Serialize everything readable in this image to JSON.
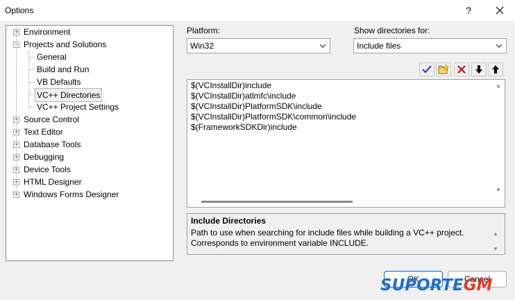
{
  "window": {
    "title": "Options",
    "help_glyph": "?",
    "close_glyph": "✕"
  },
  "tree": {
    "items": [
      {
        "label": "Environment",
        "expander": "+"
      },
      {
        "label": "Projects and Solutions",
        "expander": "−"
      },
      {
        "label": "General"
      },
      {
        "label": "Build and Run"
      },
      {
        "label": "VB Defaults"
      },
      {
        "label": "VC++ Directories",
        "selected": true
      },
      {
        "label": "VC++ Project Settings"
      },
      {
        "label": "Source Control",
        "expander": "+"
      },
      {
        "label": "Text Editor",
        "expander": "+"
      },
      {
        "label": "Database Tools",
        "expander": "+"
      },
      {
        "label": "Debugging",
        "expander": "+"
      },
      {
        "label": "Device Tools",
        "expander": "+"
      },
      {
        "label": "HTML Designer",
        "expander": "+"
      },
      {
        "label": "Windows Forms Designer",
        "expander": "+"
      }
    ]
  },
  "platform": {
    "label": "Platform:",
    "value": "Win32"
  },
  "show_dirs": {
    "label": "Show directories for:",
    "value": "Include files"
  },
  "directories": [
    "$(VCInstallDir)include",
    "$(VCInstallDir)atlmfc\\include",
    "$(VCInstallDir)PlatformSDK\\include",
    "$(VCInstallDir)PlatformSDK\\common\\include",
    "$(FrameworkSDKDir)include"
  ],
  "description": {
    "title": "Include Directories",
    "text": "Path to use when searching for include files while building a VC++ project. Corresponds to environment variable INCLUDE."
  },
  "buttons": {
    "ok": "OK",
    "cancel": "Cancel"
  },
  "watermark": {
    "part1": "SUPORTE",
    "part2": "GM"
  },
  "colors": {
    "accent": "#0067c0",
    "watermark_blue": "#1e6fd0",
    "watermark_red": "#e23a2e"
  }
}
